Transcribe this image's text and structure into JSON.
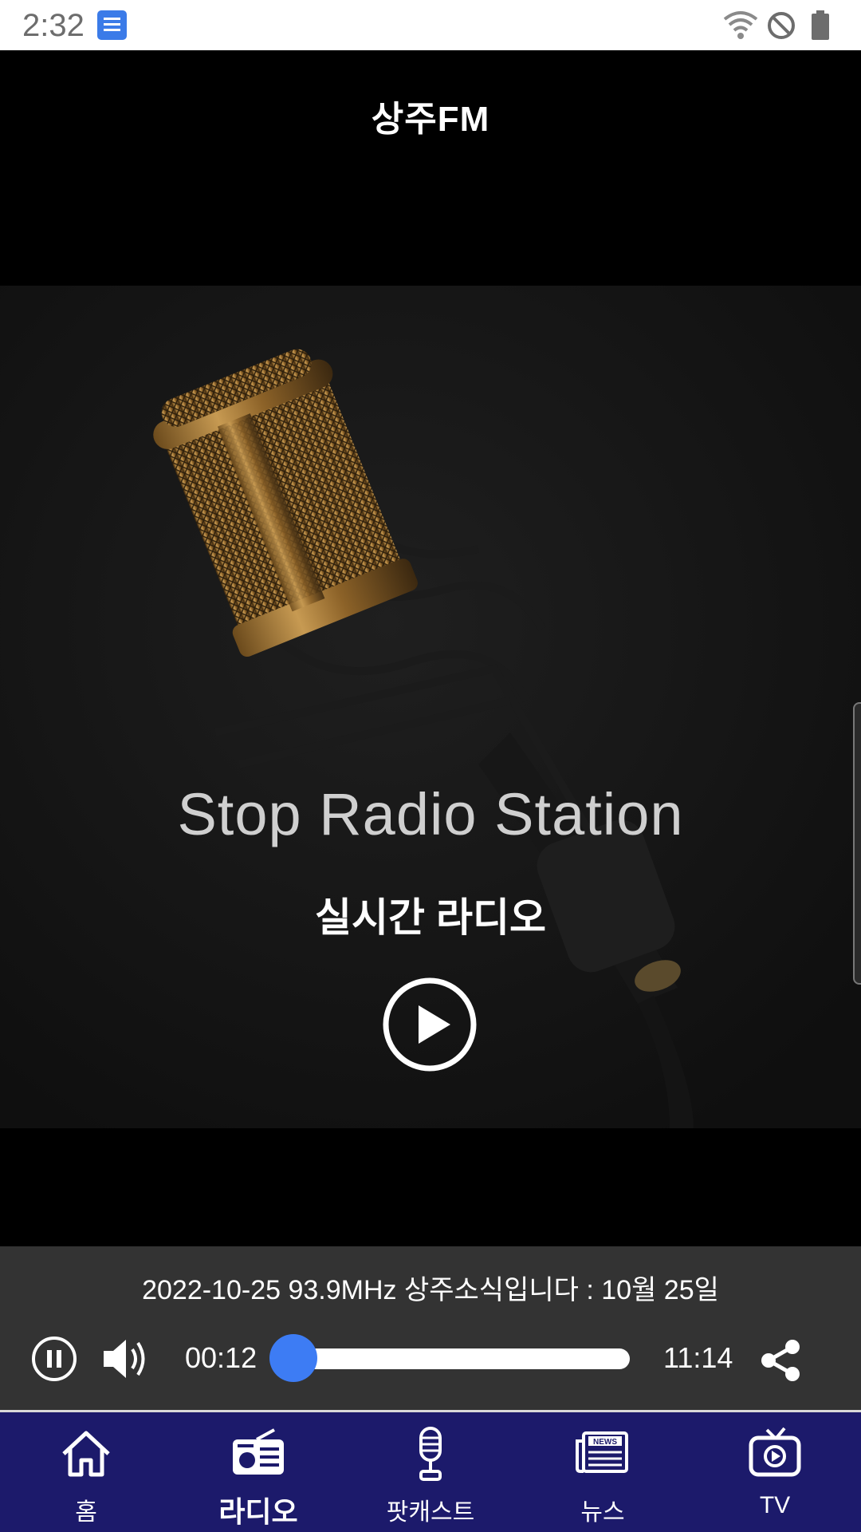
{
  "status_bar": {
    "time": "2:32",
    "app_icon": "app-notification-icon",
    "icons": [
      "wifi-icon",
      "do-not-disturb-icon",
      "battery-icon"
    ]
  },
  "header": {
    "title": "상주FM"
  },
  "hero": {
    "title": "Stop Radio Station",
    "subtitle": "실시간 라디오",
    "play_icon": "play-circle-icon"
  },
  "player": {
    "now_playing": "2022-10-25 93.9MHz 상주소식입니다 : 10월 25일",
    "current_time": "00:12",
    "total_time": "11:14",
    "progress": 0.018,
    "accent_color": "#3d7cf4"
  },
  "bottom_nav": {
    "active": "radio",
    "items": [
      {
        "label": "홈",
        "icon": "home-icon"
      },
      {
        "label": "라디오",
        "icon": "radio-icon"
      },
      {
        "label": "팟캐스트",
        "icon": "microphone-icon"
      },
      {
        "label": "뉴스",
        "icon": "news-icon"
      },
      {
        "label": "TV",
        "icon": "tv-icon"
      }
    ],
    "background_color": "#1c1a6b"
  }
}
